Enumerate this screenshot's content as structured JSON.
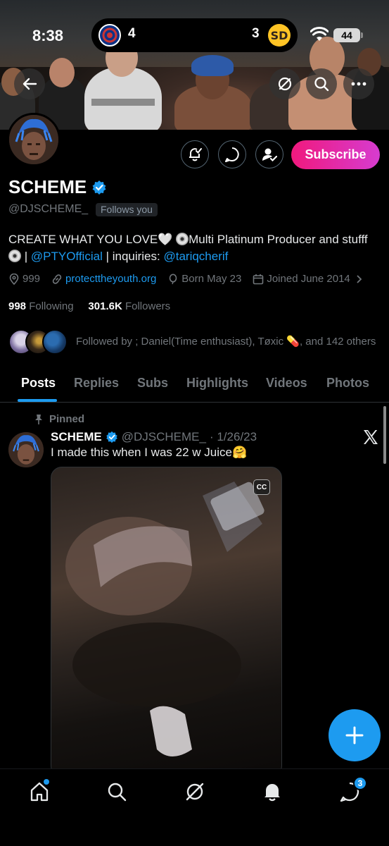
{
  "status_bar": {
    "time": "8:38",
    "score_left": "4",
    "score_right": "3",
    "battery": "44"
  },
  "profile": {
    "name": "SCHEME",
    "handle": "@DJSCHEME_",
    "follows_you": "Follows you",
    "subscribe_label": "Subscribe",
    "bio": {
      "part1": "CREATE WHAT YOU LOVE",
      "part2": "Multi Platinum Producer and stufff",
      "separator": " | ",
      "link1": "@PTYOfficial",
      "part3": " | inquiries: ",
      "link2": "@tariqcherif"
    },
    "location": "999",
    "website": "protecttheyouth.org",
    "born": "Born May 23",
    "joined": "Joined June 2014",
    "following_count": "998",
    "following_label": "Following",
    "followers_count": "301.6K",
    "followers_label": "Followers",
    "followed_by": "Followed by ; Daniel(Time enthusiast), Tøxic 💊, and 142 others"
  },
  "tabs": [
    "Posts",
    "Replies",
    "Subs",
    "Highlights",
    "Videos",
    "Photos"
  ],
  "post": {
    "pinned_label": "Pinned",
    "author_name": "SCHEME",
    "author_handle": "@DJSCHEME_",
    "date": "· 1/26/23",
    "text": "I made this when I was 22 w Juice🤗",
    "cc_label": "CC"
  },
  "nav": {
    "messages_badge": "3"
  },
  "colors": {
    "accent": "#1d9bf0",
    "subscribe_gradient_start": "#f0197d",
    "subscribe_gradient_end": "#d63cd0",
    "muted": "#71767b"
  }
}
